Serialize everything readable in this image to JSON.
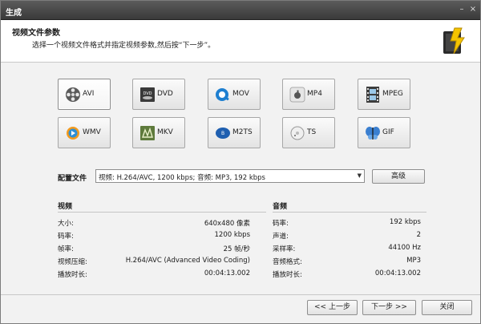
{
  "window": {
    "title": "生成",
    "minimize_glyph": "–",
    "close_glyph": "×"
  },
  "header": {
    "title": "视频文件参数",
    "subtitle": "选择一个视频文件格式并指定视频参数,然后按“下一步”。",
    "logo_icon": "wizard-magic-icon"
  },
  "formats": [
    {
      "label": "AVI",
      "icon": "film-reel-icon",
      "selected": true
    },
    {
      "label": "DVD",
      "icon": "dvd-disc-icon",
      "selected": false
    },
    {
      "label": "MOV",
      "icon": "quicktime-icon",
      "selected": false
    },
    {
      "label": "MP4",
      "icon": "apple-icon",
      "selected": false
    },
    {
      "label": "MPEG",
      "icon": "film-strip-icon",
      "selected": false
    },
    {
      "label": "WMV",
      "icon": "windows-media-icon",
      "selected": false
    },
    {
      "label": "MKV",
      "icon": "mkv-icon",
      "selected": false
    },
    {
      "label": "M2TS",
      "icon": "bluray-icon",
      "selected": false
    },
    {
      "label": "TS",
      "icon": "ts-disc-icon",
      "selected": false
    },
    {
      "label": "GIF",
      "icon": "butterfly-icon",
      "selected": false
    }
  ],
  "profile": {
    "label": "配置文件",
    "value": "视频: H.264/AVC, 1200 kbps; 音频: MP3, 192 kbps",
    "advanced_button": "高级"
  },
  "video": {
    "title": "视频",
    "rows": [
      {
        "label": "大小:",
        "value": "640x480 像素"
      },
      {
        "label": "码率:",
        "value": "1200 kbps"
      },
      {
        "label": "帧率:",
        "value": "25 帧/秒"
      },
      {
        "label": "视频压缩:",
        "value": "H.264/AVC (Advanced Video Coding)"
      },
      {
        "label": "播放时长:",
        "value": "00:04:13.002"
      }
    ]
  },
  "audio": {
    "title": "音频",
    "rows": [
      {
        "label": "码率:",
        "value": "192 kbps"
      },
      {
        "label": "声道:",
        "value": "2"
      },
      {
        "label": "采样率:",
        "value": "44100 Hz"
      },
      {
        "label": "音频格式:",
        "value": "MP3"
      },
      {
        "label": "播放时长:",
        "value": "00:04:13.002"
      }
    ]
  },
  "footer": {
    "back_button": "<< 上一步",
    "next_button": "下一步 >>",
    "close_button": "关闭"
  }
}
